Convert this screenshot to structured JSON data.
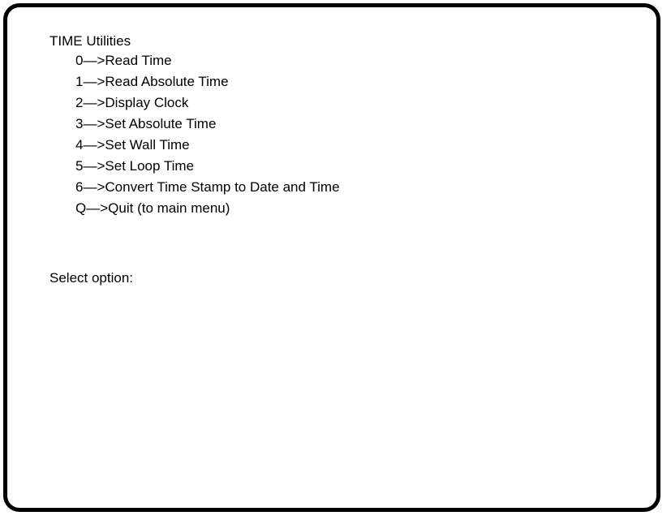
{
  "menu": {
    "title": "TIME Utilities",
    "items": [
      {
        "key": "0",
        "arrow": "—>",
        "label": "Read Time"
      },
      {
        "key": "1",
        "arrow": "—>",
        "label": "Read Absolute Time"
      },
      {
        "key": "2",
        "arrow": "—>",
        "label": "Display Clock"
      },
      {
        "key": "3",
        "arrow": "—>",
        "label": "Set Absolute Time"
      },
      {
        "key": "4",
        "arrow": "—>",
        "label": "Set Wall Time"
      },
      {
        "key": "5",
        "arrow": "—>",
        "label": "Set Loop Time"
      },
      {
        "key": "6",
        "arrow": "—>",
        "label": "Convert Time Stamp to Date and Time"
      },
      {
        "key": "Q",
        "arrow": "—>",
        "label": "Quit (to main menu)"
      }
    ]
  },
  "prompt": {
    "label": "Select option:",
    "value": ""
  }
}
